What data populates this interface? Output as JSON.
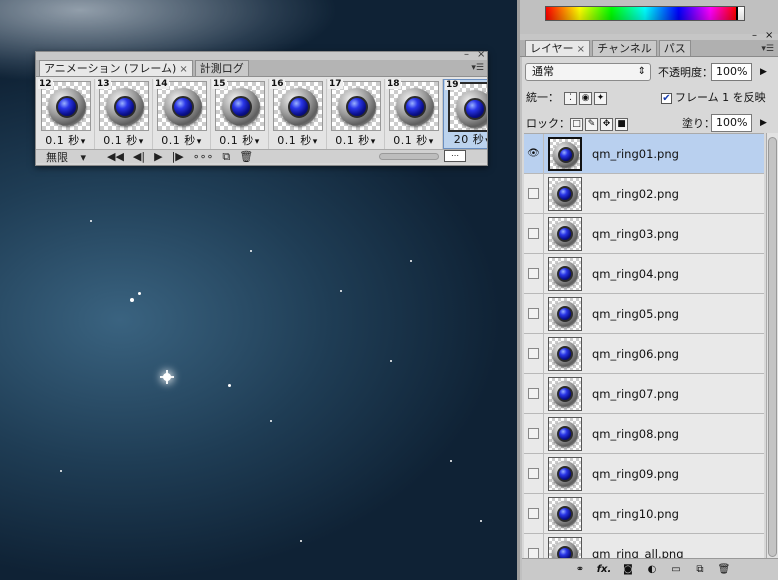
{
  "animation_panel": {
    "tabs": [
      {
        "label": "アニメーション (フレーム)",
        "close": "×",
        "active": true
      },
      {
        "label": "計測ログ",
        "close": "",
        "active": false
      }
    ],
    "frames": [
      {
        "number": "12",
        "delay": "0.1 秒"
      },
      {
        "number": "13",
        "delay": "0.1 秒"
      },
      {
        "number": "14",
        "delay": "0.1 秒"
      },
      {
        "number": "15",
        "delay": "0.1 秒"
      },
      {
        "number": "16",
        "delay": "0.1 秒"
      },
      {
        "number": "17",
        "delay": "0.1 秒"
      },
      {
        "number": "18",
        "delay": "0.1 秒"
      },
      {
        "number": "19",
        "delay": "20 秒"
      }
    ],
    "loop_option": "無限"
  },
  "layers_panel": {
    "tabs": [
      {
        "label": "レイヤー",
        "close": "×",
        "active": true
      },
      {
        "label": "チャンネル",
        "close": "",
        "active": false
      },
      {
        "label": "パス",
        "close": "",
        "active": false
      }
    ],
    "blend_mode": "通常",
    "opacity_label": "不透明度：",
    "opacity_value": "100%",
    "unify_label": "統一：",
    "propagate_label": "フレーム 1 を反映",
    "lock_label": "ロック：",
    "fill_label": "塗り：",
    "fill_value": "100%",
    "layers": [
      {
        "name": "qm_ring01.png",
        "visible": true,
        "selected": true
      },
      {
        "name": "qm_ring02.png",
        "visible": false,
        "selected": false
      },
      {
        "name": "qm_ring03.png",
        "visible": false,
        "selected": false
      },
      {
        "name": "qm_ring04.png",
        "visible": false,
        "selected": false
      },
      {
        "name": "qm_ring05.png",
        "visible": false,
        "selected": false
      },
      {
        "name": "qm_ring06.png",
        "visible": false,
        "selected": false
      },
      {
        "name": "qm_ring07.png",
        "visible": false,
        "selected": false
      },
      {
        "name": "qm_ring08.png",
        "visible": false,
        "selected": false
      },
      {
        "name": "qm_ring09.png",
        "visible": false,
        "selected": false
      },
      {
        "name": "qm_ring10.png",
        "visible": false,
        "selected": false
      },
      {
        "name": "qm_ring_all.png",
        "visible": false,
        "selected": false
      }
    ]
  }
}
